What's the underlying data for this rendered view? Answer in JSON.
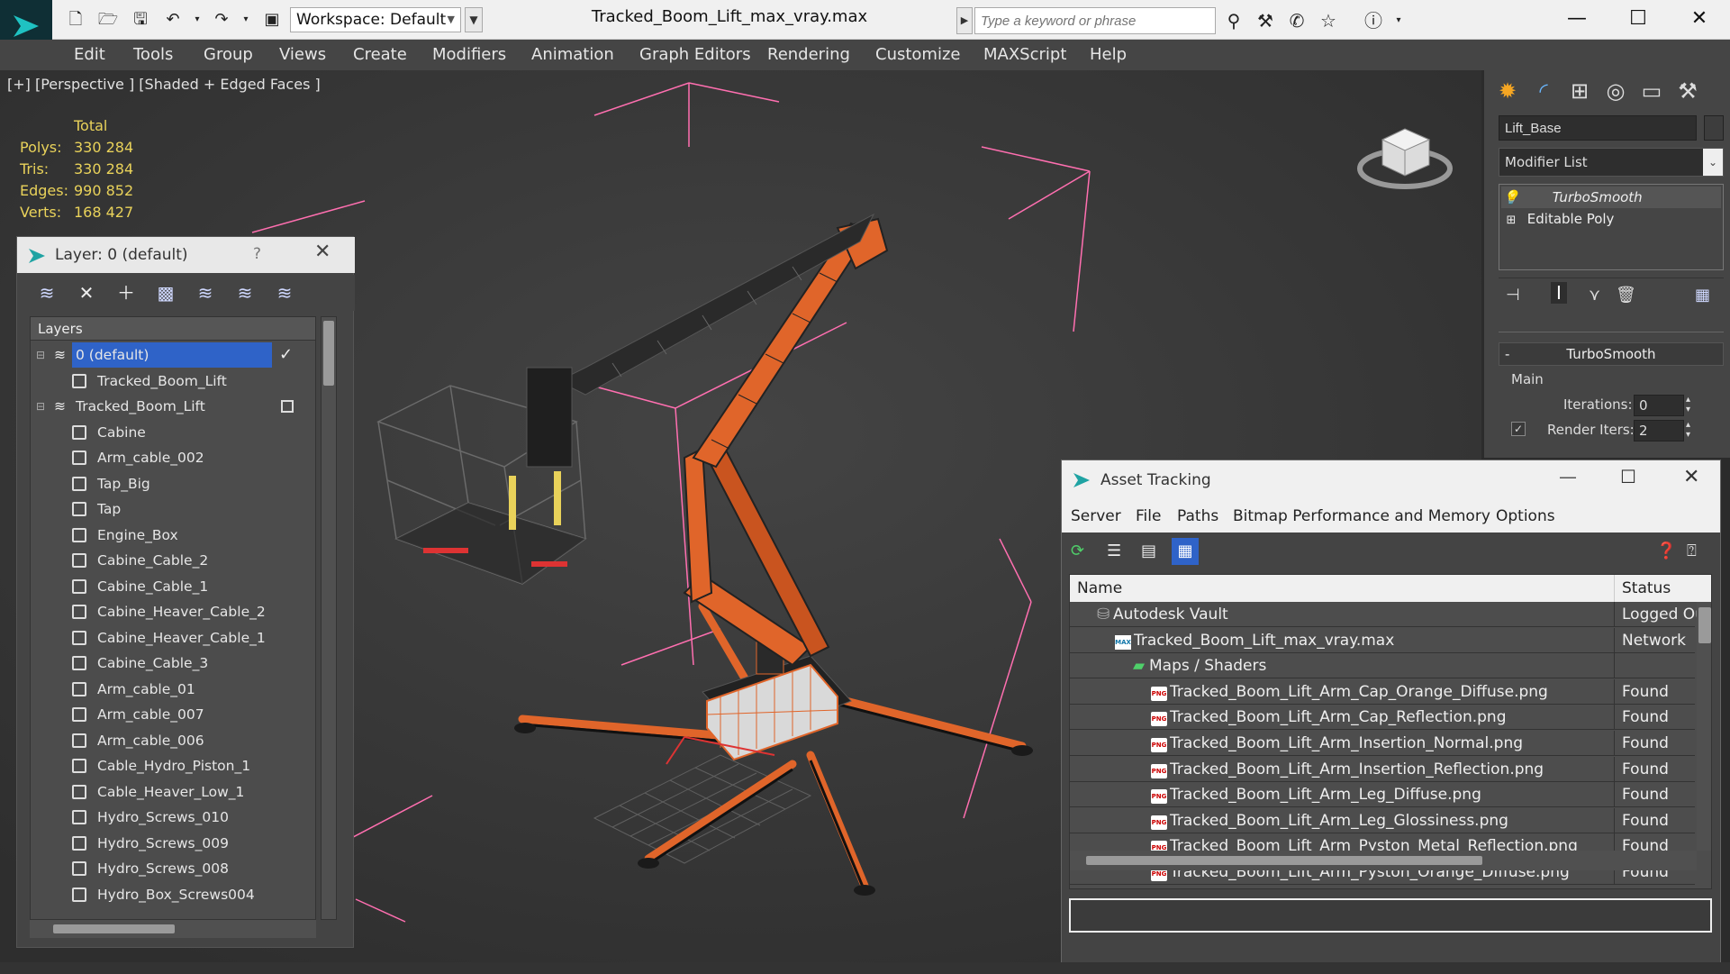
{
  "app": {
    "doc_title": "Tracked_Boom_Lift_max_vray.max",
    "workspace": "Workspace: Default",
    "search_placeholder": "Type a keyword or phrase"
  },
  "menu": [
    "Edit",
    "Tools",
    "Group",
    "Views",
    "Create",
    "Modifiers",
    "Animation",
    "Graph Editors",
    "Rendering",
    "Customize",
    "MAXScript",
    "Help"
  ],
  "viewport": {
    "label": "[+] [Perspective ] [Shaded + Edged Faces ]",
    "stats_header": "Total",
    "stats": [
      {
        "label": "Polys:",
        "value": "330 284"
      },
      {
        "label": "Tris:",
        "value": "330 284"
      },
      {
        "label": "Edges:",
        "value": "990 852"
      },
      {
        "label": "Verts:",
        "value": "168 427"
      }
    ]
  },
  "layer_panel": {
    "title": "Layer: 0 (default)",
    "help": "?",
    "header": "Layers",
    "rows": [
      {
        "label": "0 (default)",
        "level": 0,
        "selected": true
      },
      {
        "label": "Tracked_Boom_Lift",
        "level": 1
      },
      {
        "label": "Tracked_Boom_Lift",
        "level": 0
      },
      {
        "label": "Cabine",
        "level": 1
      },
      {
        "label": "Arm_cable_002",
        "level": 1
      },
      {
        "label": "Tap_Big",
        "level": 1
      },
      {
        "label": "Tap",
        "level": 1
      },
      {
        "label": "Engine_Box",
        "level": 1
      },
      {
        "label": "Cabine_Cable_2",
        "level": 1
      },
      {
        "label": "Cabine_Cable_1",
        "level": 1
      },
      {
        "label": "Cabine_Heaver_Cable_2",
        "level": 1
      },
      {
        "label": "Cabine_Heaver_Cable_1",
        "level": 1
      },
      {
        "label": "Cabine_Cable_3",
        "level": 1
      },
      {
        "label": "Arm_cable_01",
        "level": 1
      },
      {
        "label": "Arm_cable_007",
        "level": 1
      },
      {
        "label": "Arm_cable_006",
        "level": 1
      },
      {
        "label": "Cable_Hydro_Piston_1",
        "level": 1
      },
      {
        "label": "Cable_Heaver_Low_1",
        "level": 1
      },
      {
        "label": "Hydro_Screws_010",
        "level": 1
      },
      {
        "label": "Hydro_Screws_009",
        "level": 1
      },
      {
        "label": "Hydro_Screws_008",
        "level": 1
      },
      {
        "label": "Hydro_Box_Screws004",
        "level": 1
      }
    ]
  },
  "command_panel": {
    "object_name": "Lift_Base",
    "modifier_list": "Modifier List",
    "stack": [
      "TurboSmooth",
      "Editable Poly"
    ],
    "rollout_title": "TurboSmooth",
    "rollout_sign": "-",
    "group": "Main",
    "iterations_label": "Iterations:",
    "iterations_value": "0",
    "render_iters_label": "Render Iters:",
    "render_iters_value": "2"
  },
  "asset_tracking": {
    "title": "Asset Tracking",
    "menu": [
      "Server",
      "File",
      "Paths",
      "Bitmap Performance and Memory",
      "Options"
    ],
    "col_name": "Name",
    "col_status": "Status",
    "rows": [
      {
        "name": "Autodesk Vault",
        "status": "Logged Out",
        "indent": 30,
        "icon": "vault"
      },
      {
        "name": "Tracked_Boom_Lift_max_vray.max",
        "status": "Network",
        "indent": 50,
        "icon": "max"
      },
      {
        "name": "Maps / Shaders",
        "status": "",
        "indent": 70,
        "icon": "maps"
      },
      {
        "name": "Tracked_Boom_Lift_Arm_Cap_Orange_Diffuse.png",
        "status": "Found",
        "indent": 90,
        "icon": "png"
      },
      {
        "name": "Tracked_Boom_Lift_Arm_Cap_Reflection.png",
        "status": "Found",
        "indent": 90,
        "icon": "png"
      },
      {
        "name": "Tracked_Boom_Lift_Arm_Insertion_Normal.png",
        "status": "Found",
        "indent": 90,
        "icon": "png"
      },
      {
        "name": "Tracked_Boom_Lift_Arm_Insertion_Reflection.png",
        "status": "Found",
        "indent": 90,
        "icon": "png"
      },
      {
        "name": "Tracked_Boom_Lift_Arm_Leg_Diffuse.png",
        "status": "Found",
        "indent": 90,
        "icon": "png"
      },
      {
        "name": "Tracked_Boom_Lift_Arm_Leg_Glossiness.png",
        "status": "Found",
        "indent": 90,
        "icon": "png"
      },
      {
        "name": "Tracked_Boom_Lift_Arm_Pyston_Metal_Reflection.png",
        "status": "Found",
        "indent": 90,
        "icon": "png"
      },
      {
        "name": "Tracked_Boom_Lift_Arm_Pyston_Orange_Diffuse.png",
        "status": "Found",
        "indent": 90,
        "icon": "png"
      }
    ]
  },
  "colors": {
    "accent": "#2f63c8",
    "lift_orange": "#e0652a",
    "stats_yellow": "#e9d25a",
    "bbox_pink": "#ff6fb0"
  }
}
